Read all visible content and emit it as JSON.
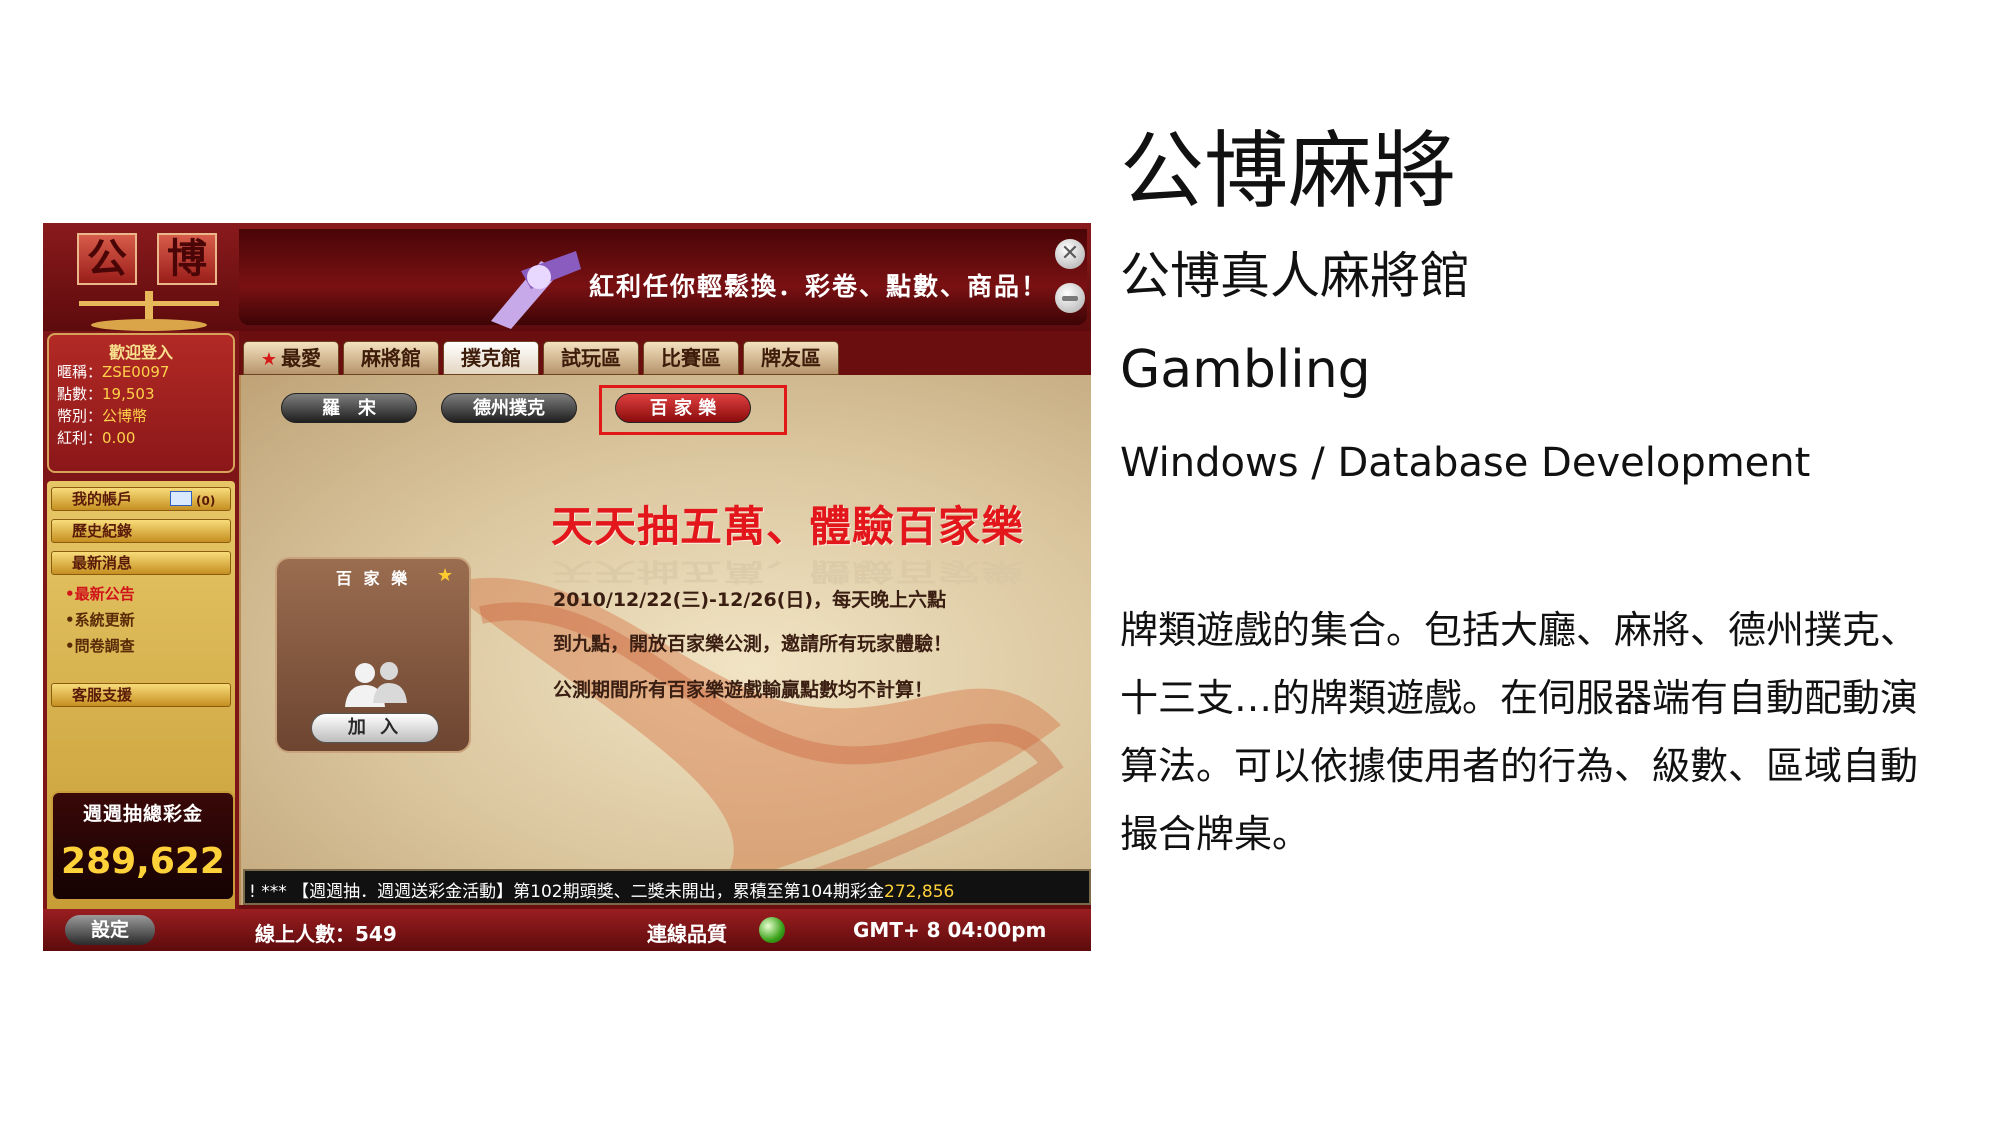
{
  "screenshot": {
    "logo": {
      "char1": "公",
      "char2": "博"
    },
    "banner_text": "紅利任你輕鬆換．彩卷、點數、商品！",
    "window_buttons": {
      "close": "✕",
      "minimize": "—"
    },
    "welcome": {
      "title": "歡迎登入",
      "nickname_label": "暱稱：",
      "nickname": "ZSE0097",
      "points_label": "點數：",
      "points": "19,503",
      "currency_label": "幣別：",
      "currency": "公博幣",
      "bonus_label": "紅利：",
      "bonus": "0.00"
    },
    "menu": {
      "my_account": "我的帳戶",
      "mail_count": "(0)",
      "history": "歷史紀錄",
      "news": "最新消息",
      "news_items": [
        "•最新公告",
        "•系統更新",
        "•問卷調查"
      ],
      "support": "客服支援"
    },
    "jackpot": {
      "title": "週週抽總彩金",
      "amount": "289,622"
    },
    "tabs": [
      "最愛",
      "麻將館",
      "撲克館",
      "試玩區",
      "比賽區",
      "牌友區"
    ],
    "active_tab_index": 2,
    "subtabs": [
      "羅　宋",
      "德州撲克",
      "百 家 樂"
    ],
    "active_subtab_index": 2,
    "promo": {
      "title": "天天抽五萬、體驗百家樂",
      "line1": "2010/12/22(三)-12/26(日)，每天晚上六點",
      "line2": "到九點，開放百家樂公測，邀請所有玩家體驗！",
      "line3": "公測期間所有百家樂遊戲輸贏點數均不計算！"
    },
    "game_card": {
      "title": "百 家 樂",
      "join_label": "加 入"
    },
    "marquee": {
      "text": "! *** 【週週抽．週週送彩金活動】第102期頭獎、二獎未開出，累積至第104期彩金",
      "amount": "272,856"
    },
    "statusbar": {
      "settings": "設定",
      "online_label": "線上人數：549",
      "connection_label": "連線品質",
      "time": "GMT+ 8  04:00pm"
    },
    "colors": {
      "accent_red": "#e01818",
      "frame": "#6b0e10",
      "gold": "#ffd23a"
    }
  },
  "info": {
    "title": "公博麻將",
    "subtitle": "公博真人麻將館",
    "category": "Gambling",
    "tech": "Windows / Database Development",
    "description": "牌類遊戲的集合。包括大廳、麻將、德州撲克、十三支…的牌類遊戲。在伺服器端有自動配動演算法。可以依據使用者的行為、級數、區域自動撮合牌桌。"
  }
}
